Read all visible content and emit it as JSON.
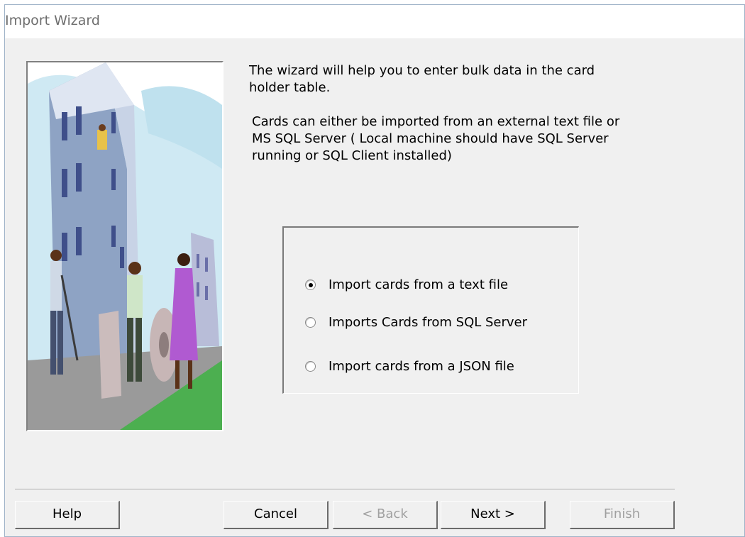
{
  "window": {
    "title": "Import Wizard"
  },
  "intro": {
    "line1": "The wizard will help you to enter bulk data in the card holder table.",
    "line2": "Cards can either be imported from an external text file or MS SQL Server ( Local machine should have SQL Server running or SQL Client installed)"
  },
  "options": [
    {
      "label": "Import cards from a text file",
      "checked": true
    },
    {
      "label": "Imports Cards from SQL Server",
      "checked": false
    },
    {
      "label": "Import cards from a JSON file",
      "checked": false
    }
  ],
  "buttons": {
    "help": "Help",
    "cancel": "Cancel",
    "back": "< Back",
    "next": "Next >",
    "finish": "Finish"
  },
  "illustration": {
    "icon": "office-building-clipart"
  }
}
